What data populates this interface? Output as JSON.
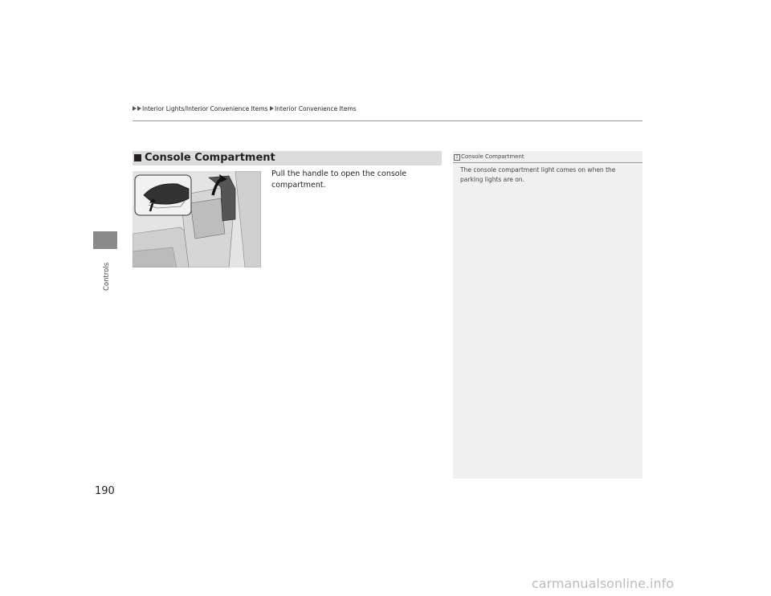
{
  "header": {
    "breadcrumb_1": "Interior Lights/Interior Convenience Items",
    "breadcrumb_2": "Interior Convenience Items"
  },
  "side_tab": {
    "label": "Controls"
  },
  "section": {
    "title": "Console Compartment",
    "body": "Pull the handle to open the console compartment."
  },
  "note": {
    "title": "Console Compartment",
    "text": "The console compartment light comes on when the parking lights are on."
  },
  "page_number": "190",
  "watermark": "carmanualsonline.info"
}
